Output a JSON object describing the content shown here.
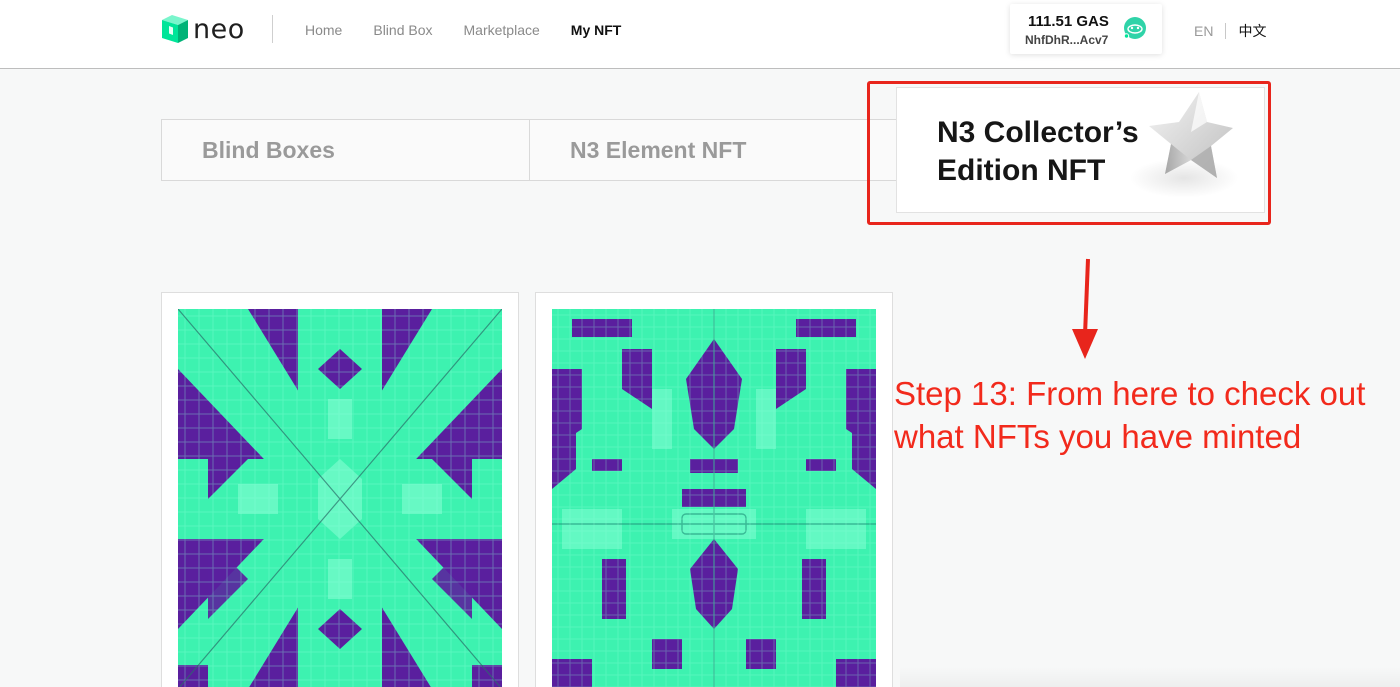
{
  "header": {
    "logo_text": "neo",
    "nav": [
      {
        "label": "Home",
        "active": false
      },
      {
        "label": "Blind Box",
        "active": false
      },
      {
        "label": "Marketplace",
        "active": false
      },
      {
        "label": "My NFT",
        "active": true
      }
    ],
    "wallet": {
      "amount": "111.51 GAS",
      "address": "NhfDhR...Acv7",
      "avatar_icon": "wallet-avatar-icon"
    },
    "lang": {
      "en": "EN",
      "zh": "中文"
    }
  },
  "tabs": [
    {
      "label": "Blind Boxes",
      "active": false
    },
    {
      "label": "N3 Element NFT",
      "active": false
    },
    {
      "label": "N3 Collector’s Edition NFT",
      "active": true,
      "icon": "star-icon"
    }
  ],
  "cards": [
    {
      "art": "nft-artwork"
    },
    {
      "art": "nft-artwork"
    }
  ],
  "annotation": {
    "text": "Step 13: From here to check out what NFTs you have minted",
    "color": "#f22a1c"
  },
  "colors": {
    "brand_green": "#00e599",
    "art_green": "#3df2b0",
    "art_purple": "#5a1f9e",
    "highlight_red": "#e8251c"
  }
}
